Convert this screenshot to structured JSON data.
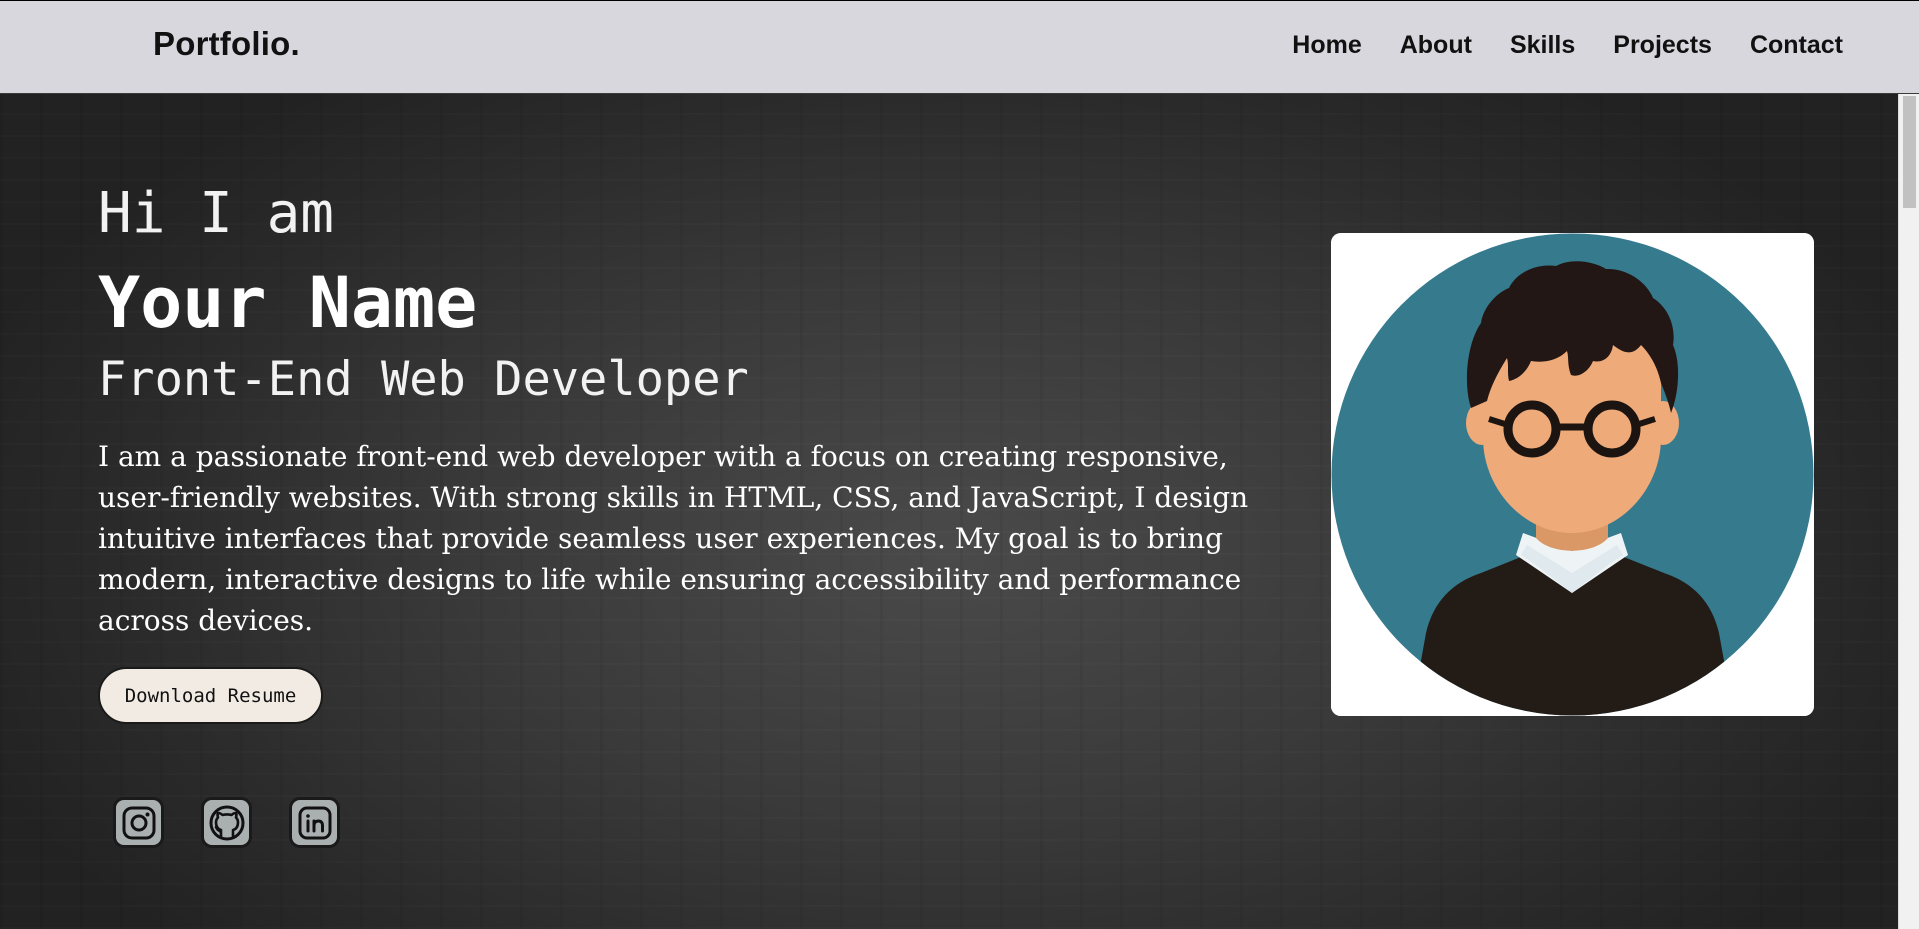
{
  "header": {
    "brand": "Portfolio.",
    "nav": [
      "Home",
      "About",
      "Skills",
      "Projects",
      "Contact"
    ]
  },
  "hero": {
    "greeting": "Hi I am",
    "name": "Your Name",
    "role": "Front-End Web Developer",
    "bio": "I am a passionate front-end web developer with a focus on creating responsive, user-friendly websites. With strong skills in HTML, CSS, and JavaScript, I design intuitive interfaces that provide seamless user experiences. My goal is to bring modern, interactive designs to life while ensuring accessibility and performance across devices.",
    "resume_button": "Download Resume"
  },
  "socials": [
    {
      "icon": "instagram-icon"
    },
    {
      "icon": "github-icon"
    },
    {
      "icon": "linkedin-icon"
    }
  ],
  "colors": {
    "navbar_bg": "#d8d7de",
    "hero_bg": "#3a3a3a",
    "button_bg": "#f1ebe3",
    "avatar_circle": "#367a8e",
    "avatar_skin": "#eeaa78",
    "avatar_sweater": "#231c16"
  }
}
